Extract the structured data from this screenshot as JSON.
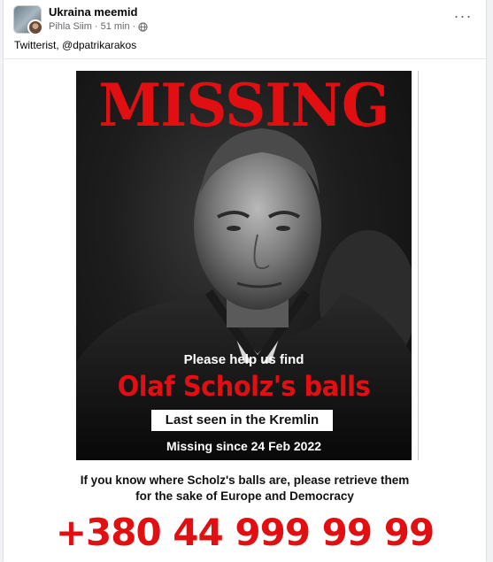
{
  "post": {
    "group_name": "Ukraina meemid",
    "author": "Pihla Siim",
    "separator": "·",
    "time": "51 min",
    "privacy_icon": "globe-icon",
    "more_icon": "more-options-icon",
    "more_label": "···",
    "caption": "Twitterist, @dpatrikarakos"
  },
  "poster": {
    "title": "MISSING",
    "help_text": "Please help us find",
    "target": "Olaf Scholz's balls",
    "last_seen": "Last seen in the Kremlin",
    "since": "Missing since 24 Feb 2022",
    "plea_line_1": "If you know where Scholz's balls are, please retrieve them",
    "plea_line_2": "for the sake of Europe and Democracy",
    "phone": "+380 44 999 99 99"
  },
  "colors": {
    "accent_red": "#e10f12",
    "page_bg": "#f0f2f5",
    "card_bg": "#ffffff",
    "meta_text": "#65676b"
  }
}
